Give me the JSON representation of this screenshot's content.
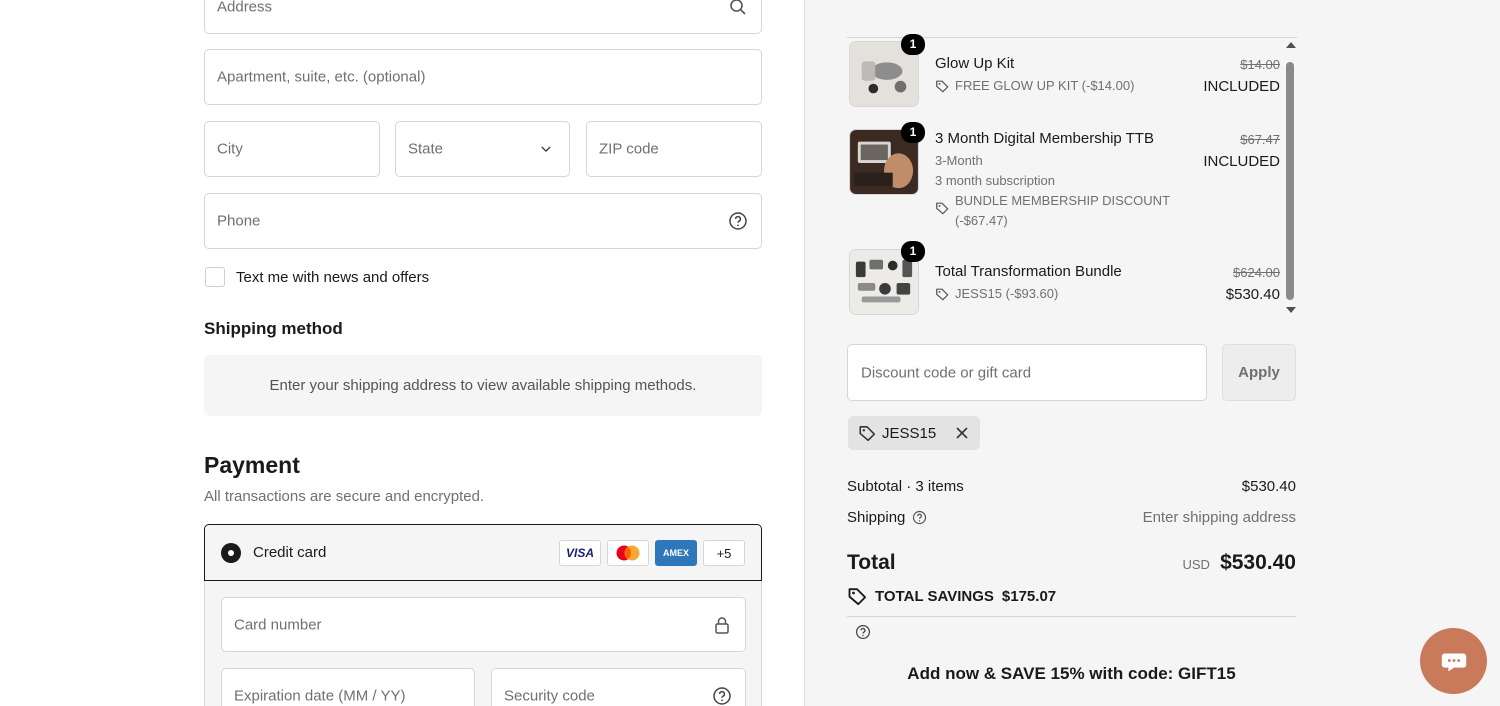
{
  "delivery": {
    "address_placeholder": "Address",
    "apartment_placeholder": "Apartment, suite, etc. (optional)",
    "city_placeholder": "City",
    "state_value": "State",
    "zip_placeholder": "ZIP code",
    "phone_placeholder": "Phone",
    "sms_optin_label": "Text me with news and offers"
  },
  "shipping_method": {
    "heading": "Shipping method",
    "empty_message": "Enter your shipping address to view available shipping methods."
  },
  "payment": {
    "heading": "Payment",
    "subtitle": "All transactions are secure and encrypted.",
    "method_label": "Credit card",
    "card_brands": [
      "VISA",
      "Mastercard",
      "AMEX",
      "+5"
    ],
    "card_number_placeholder": "Card number",
    "expiry_placeholder": "Expiration date (MM / YY)",
    "security_placeholder": "Security code"
  },
  "order": {
    "items": [
      {
        "qty": "1",
        "name": "Glow Up Kit",
        "discount": "FREE GLOW UP KIT (-$14.00)",
        "original_price": "$14.00",
        "price": "INCLUDED"
      },
      {
        "qty": "1",
        "name": "3 Month Digital Membership TTB",
        "variant": "3-Month",
        "plan": "3 month subscription",
        "discount_line1": "BUNDLE MEMBERSHIP DISCOUNT",
        "discount_line2": "(-$67.47)",
        "original_price": "$67.47",
        "price": "INCLUDED"
      },
      {
        "qty": "1",
        "name": "Total Transformation Bundle",
        "discount": "JESS15 (-$93.60)",
        "original_price": "$624.00",
        "price": "$530.40"
      }
    ],
    "discount_placeholder": "Discount code or gift card",
    "apply_label": "Apply",
    "applied_code": "JESS15",
    "subtotal_label": "Subtotal · 3 items",
    "subtotal_value": "$530.40",
    "shipping_label": "Shipping",
    "shipping_value": "Enter shipping address",
    "total_label": "Total",
    "currency": "USD",
    "total_value": "$530.40",
    "savings_label": "TOTAL SAVINGS",
    "savings_value": "$175.07",
    "promo_text": "Add now & SAVE 15% with code: GIFT15"
  },
  "colors": {
    "accent_chat": "#c97a5a",
    "summary_bg": "#f5f5f5",
    "amex_blue": "#2e77bb"
  },
  "icons": [
    "search-icon",
    "chevron-down-icon",
    "help-icon",
    "lock-icon",
    "tag-icon",
    "close-icon",
    "chat-icon"
  ]
}
